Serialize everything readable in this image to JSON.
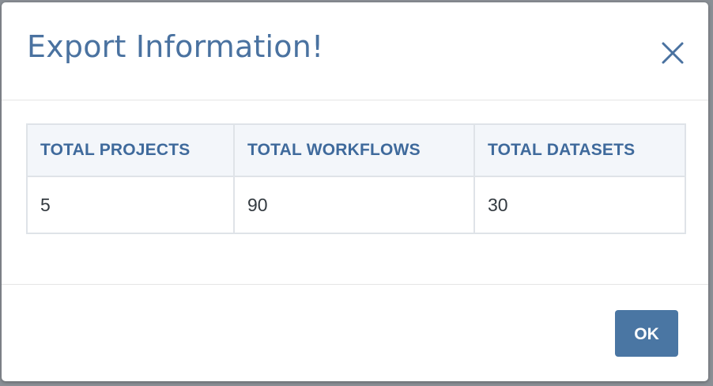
{
  "dialog": {
    "title": "Export Information!",
    "close_icon": "close-icon",
    "ok_label": "OK"
  },
  "table": {
    "columns": [
      "TOTAL PROJECTS",
      "TOTAL WORKFLOWS",
      "TOTAL DATASETS"
    ],
    "rows": [
      [
        "5",
        "90",
        "30"
      ]
    ]
  },
  "colors": {
    "accent": "#4a72a0",
    "header_bg": "#f3f6fa",
    "button_bg": "#4a76a3",
    "border": "#dfe3e8"
  }
}
